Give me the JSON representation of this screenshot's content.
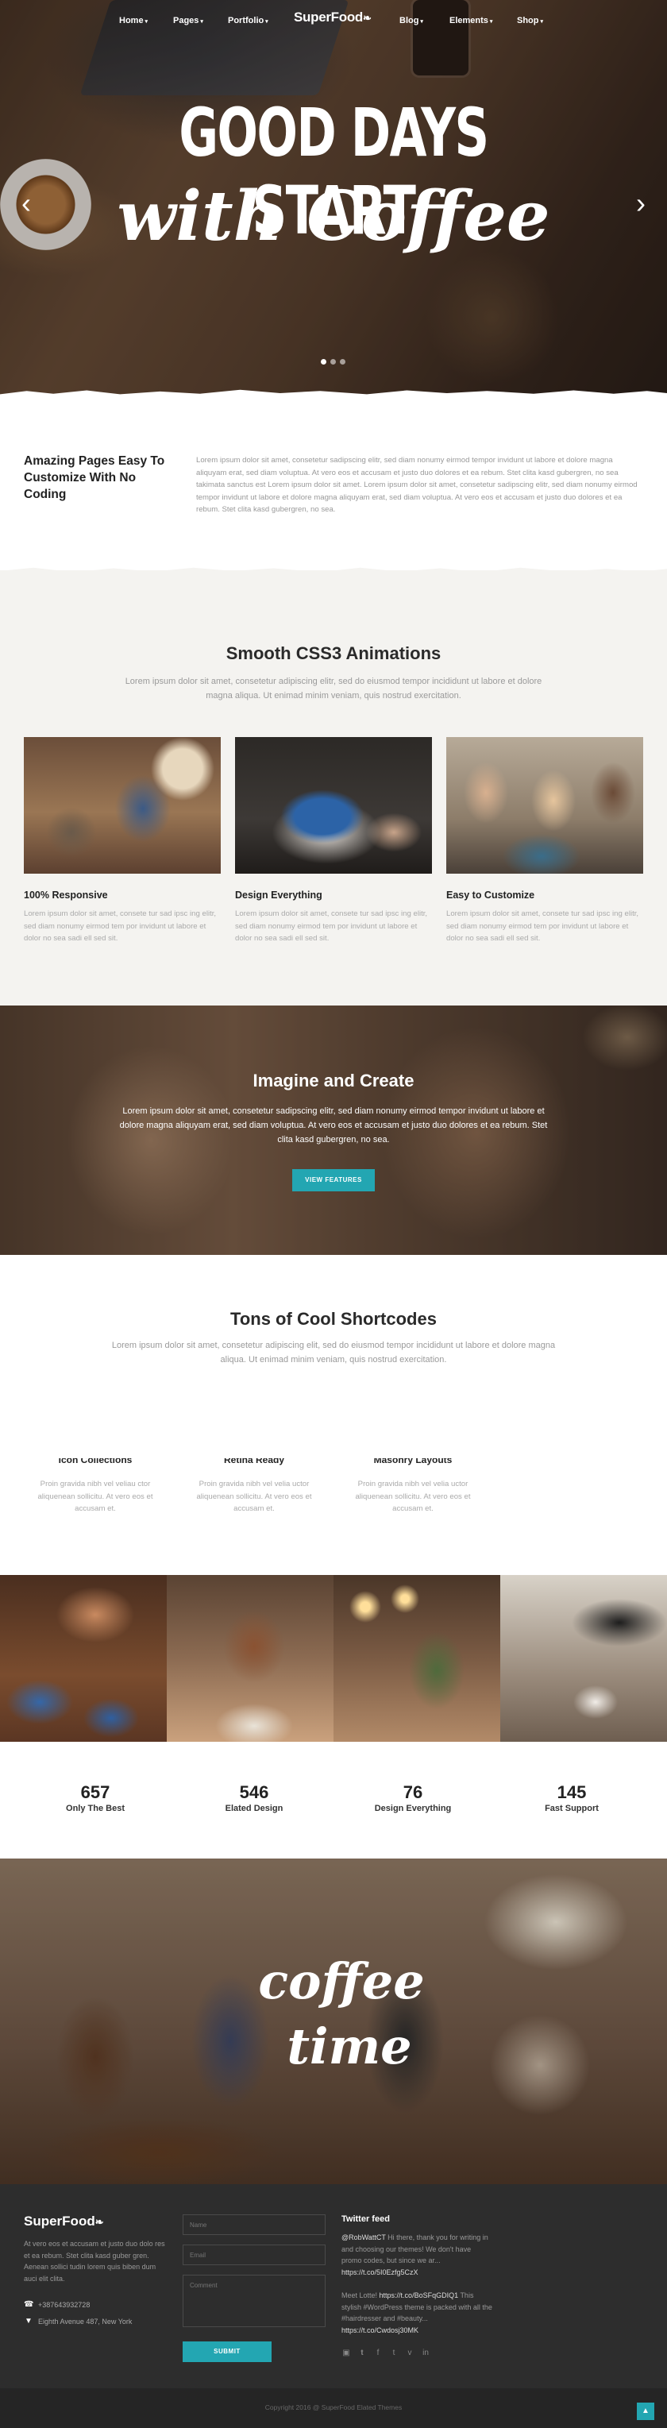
{
  "nav": {
    "items_left": [
      "Home",
      "Pages",
      "Portfolio"
    ],
    "logo": "SuperFood",
    "items_right": [
      "Blog",
      "Elements",
      "Shop"
    ]
  },
  "hero": {
    "line1": "GOOD DAYS START",
    "line2": "with Coffee",
    "slide_count": 3,
    "active_slide": 1
  },
  "intro": {
    "title": "Amazing Pages Easy To Customize With No Coding",
    "text": "Lorem ipsum dolor sit amet, consetetur sadipscing elitr, sed diam nonumy eirmod tempor invidunt ut labore et dolore magna aliquyam erat, sed diam voluptua. At vero eos et accusam et justo duo dolores et ea rebum. Stet clita kasd gubergren, no sea takimata sanctus est Lorem ipsum dolor sit amet. Lorem ipsum dolor sit amet, consetetur sadipscing elitr, sed diam nonumy eirmod tempor invidunt ut labore et dolore magna aliquyam erat, sed diam voluptua. At vero eos et accusam et justo duo dolores et ea rebum. Stet clita kasd gubergren, no sea."
  },
  "features": {
    "title": "Smooth CSS3 Animations",
    "subtitle": "Lorem ipsum dolor sit amet, consetetur adipiscing elitr, sed do eiusmod tempor incididunt ut labore et dolore magna aliqua. Ut enimad minim veniam, quis nostrud exercitation.",
    "items": [
      {
        "title": "100% Responsive",
        "text": "Lorem ipsum dolor sit amet, consete tur sad ipsc ing elitr, sed diam nonumy eirmod tem por invidunt ut labore et dolor no sea sadi ell sed sit."
      },
      {
        "title": "Design Everything",
        "text": "Lorem ipsum dolor sit amet, consete tur sad ipsc ing elitr, sed diam nonumy eirmod tem por invidunt ut labore et dolor no sea sadi ell sed sit."
      },
      {
        "title": "Easy to Customize",
        "text": "Lorem ipsum dolor sit amet, consete tur sad ipsc ing elitr, sed diam nonumy eirmod tem por invidunt ut labore et dolor no sea sadi ell sed sit."
      }
    ]
  },
  "imagine": {
    "title": "Imagine and Create",
    "text": "Lorem ipsum dolor sit amet, consetetur sadipscing elitr, sed diam nonumy eirmod tempor invidunt ut labore et dolore magna aliquyam erat, sed diam voluptua. At vero eos et accusam et justo duo dolores et ea rebum. Stet clita kasd gubergren, no sea.",
    "button": "VIEW FEATURES"
  },
  "shortcodes": {
    "title": "Tons of Cool Shortcodes",
    "subtitle": "Lorem ipsum dolor sit amet, consetetur adipiscing elit, sed do eiusmod tempor incididunt ut labore et dolore magna aliqua. Ut enimad minim veniam, quis nostrud exercitation.",
    "items": [
      {
        "title": "Icon Collections",
        "text": "Proin gravida nibh vel veliau ctor aliquenean sollicitu. At vero eos et accusam et."
      },
      {
        "title": "Retina Ready",
        "text": "Proin gravida nibh vel velia uctor aliquenean sollicitu. At vero eos et accusam et."
      },
      {
        "title": "Masonry Layouts",
        "text": "Proin gravida nibh vel velia uctor aliquenean sollicitu. At vero eos et accusam et."
      }
    ]
  },
  "counters": [
    {
      "value": "657",
      "label": "Only The Best"
    },
    {
      "value": "546",
      "label": "Elated Design"
    },
    {
      "value": "76",
      "label": "Design Everything"
    },
    {
      "value": "145",
      "label": "Fast Support"
    }
  ],
  "coffee_time": {
    "line1": "coffee",
    "line2": "time"
  },
  "footer": {
    "logo": "SuperFood",
    "about": "At vero eos et accusam et justo duo dolo res et ea rebum. Stet clita kasd guber gren. Aenean sollici tudin lorem quis biben dum auci elit clita.",
    "phone": "+387643932728",
    "address": "Eighth Avenue 487, New York",
    "form": {
      "name_placeholder": "Name",
      "email_placeholder": "Email",
      "comment_placeholder": "Comment",
      "submit": "SUBMIT"
    },
    "twitter": {
      "title": "Twitter feed",
      "tweets": [
        {
          "handle": "@RobWattCT",
          "text": "Hi there, thank you for writing in and choosing our themes! We don't have promo codes, but since we ar...",
          "link": "https://t.co/5I0Ezfg5CzX"
        },
        {
          "prefix": "Meet Lotte!",
          "link": "https://t.co/BoSFqGDIQ1",
          "text": "This stylish #WordPress theme is packed with all the #hairdresser and #beauty...",
          "link2": "https://t.co/Cwdosj30MK"
        }
      ],
      "social_icons": [
        "instagram-icon",
        "twitter-icon",
        "facebook-icon",
        "tumblr-icon",
        "vimeo-icon",
        "linkedin-icon"
      ]
    },
    "copyright": "Copyright 2016 @ SuperFood Elated Themes"
  },
  "colors": {
    "accent": "#23a6b2",
    "footer_bg": "#2d2d2d",
    "section_bg": "#f4f3f0"
  }
}
